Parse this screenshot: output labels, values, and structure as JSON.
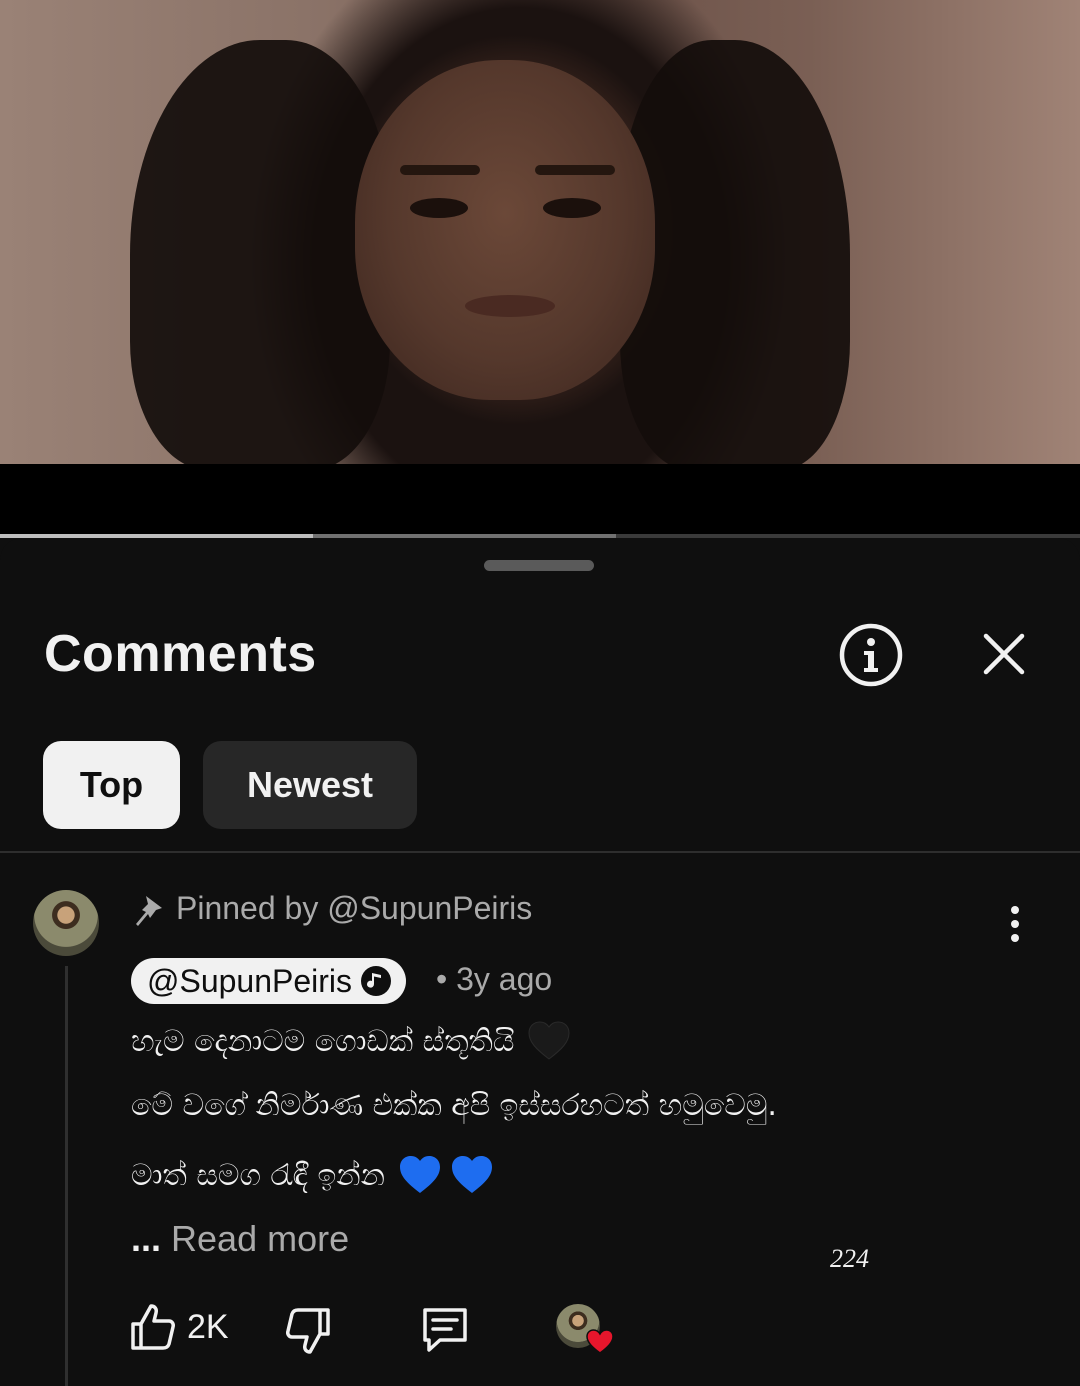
{
  "video": {
    "progress_played": 0.29,
    "progress_buffered": 0.57
  },
  "comments": {
    "title": "Comments",
    "info_icon": "info-icon",
    "close_icon": "close-icon",
    "tabs": [
      {
        "label": "Top",
        "selected": true
      },
      {
        "label": "Newest",
        "selected": false
      }
    ]
  },
  "comment": {
    "pinned_label": "Pinned by @SupunPeiris",
    "author": "@SupunPeiris",
    "time": "3y ago",
    "lines": [
      "හැම දෙනාටම ගොඩක් ස්තූතියි",
      "මේ වගේ නිර්මාණ එක්ක අපි ඉස්සරහටත් හමුවෙමු.",
      "මාත් සමග රැඳී ඉන්න"
    ],
    "read_more_dots": "...",
    "read_more": "Read more",
    "like_count": "2K",
    "overlay_number": "224"
  },
  "colors": {
    "background": "#0f0f0f",
    "chip_selected": "#f1f1f1",
    "chip_unselected": "#272727",
    "secondary_text": "#aaaaaa",
    "black_heart": "#1a1a1a",
    "blue_heart": "#1e6df0",
    "red_heart": "#e6162c"
  }
}
